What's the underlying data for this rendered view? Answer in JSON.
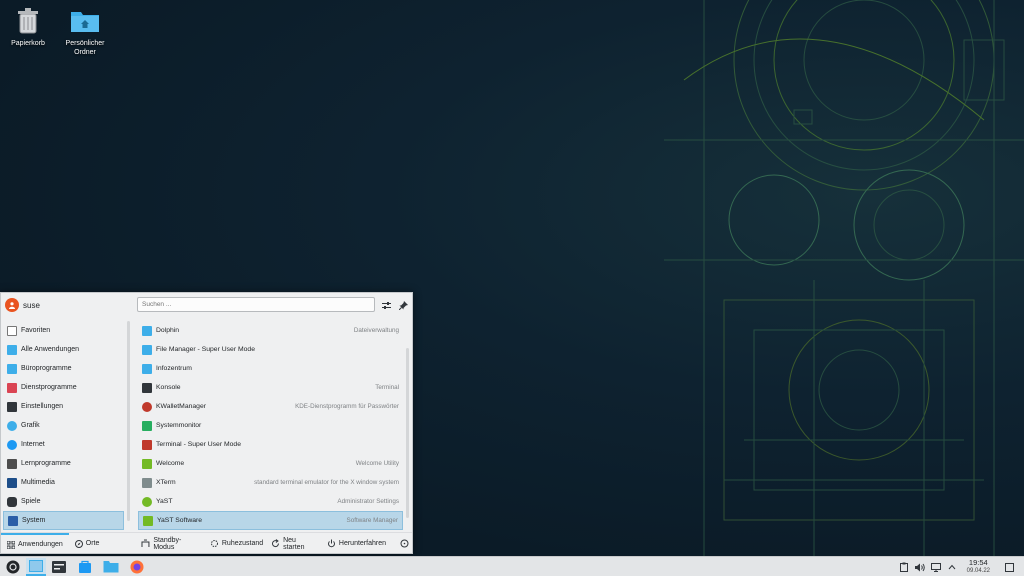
{
  "desktop": {
    "icons": [
      {
        "label": "Papierkorb",
        "icon": "trash-icon"
      },
      {
        "label": "Persönlicher Ordner",
        "icon": "home-folder-icon"
      }
    ]
  },
  "launcher": {
    "user": "suse",
    "search_placeholder": "Suchen ...",
    "categories": [
      {
        "label": "Favoriten",
        "icon": "bookmark-icon",
        "color": "#ffffff"
      },
      {
        "label": "Alle Anwendungen",
        "icon": "grid-icon",
        "color": "#3daee9"
      },
      {
        "label": "Büroprogramme",
        "icon": "office-icon",
        "color": "#3daee9"
      },
      {
        "label": "Dienstprogramme",
        "icon": "utilities-icon",
        "color": "#da4453"
      },
      {
        "label": "Einstellungen",
        "icon": "settings-icon",
        "color": "#31363b"
      },
      {
        "label": "Grafik",
        "icon": "graphics-icon",
        "color": "#3daee9"
      },
      {
        "label": "Internet",
        "icon": "globe-icon",
        "color": "#1d99f3"
      },
      {
        "label": "Lernprogramme",
        "icon": "education-icon",
        "color": "#4d4d4d"
      },
      {
        "label": "Multimedia",
        "icon": "multimedia-icon",
        "color": "#1d4e89"
      },
      {
        "label": "Spiele",
        "icon": "gamepad-icon",
        "color": "#31363b"
      },
      {
        "label": "System",
        "icon": "system-icon",
        "color": "#2b5ea7"
      }
    ],
    "active_category": "System",
    "apps": [
      {
        "name": "Dolphin",
        "desc": "Dateiverwaltung",
        "icon": "folder-icon",
        "color": "#3daee9"
      },
      {
        "name": "File Manager - Super User Mode",
        "desc": "",
        "icon": "folder-icon",
        "color": "#3daee9"
      },
      {
        "name": "Infozentrum",
        "desc": "",
        "icon": "info-icon",
        "color": "#3daee9"
      },
      {
        "name": "Konsole",
        "desc": "Terminal",
        "icon": "terminal-icon",
        "color": "#31363b"
      },
      {
        "name": "KWalletManager",
        "desc": "KDE-Dienstprogramm für Passwörter",
        "icon": "wallet-icon",
        "color": "#c0392b"
      },
      {
        "name": "Systemmonitor",
        "desc": "",
        "icon": "monitor-icon",
        "color": "#27ae60"
      },
      {
        "name": "Terminal - Super User Mode",
        "desc": "",
        "icon": "terminal-icon",
        "color": "#c0392b"
      },
      {
        "name": "Welcome",
        "desc": "Welcome Utility",
        "icon": "welcome-icon",
        "color": "#73ba25"
      },
      {
        "name": "XTerm",
        "desc": "standard terminal emulator for the X window system",
        "icon": "xterm-icon",
        "color": "#7f8c8d"
      },
      {
        "name": "YaST",
        "desc": "Administrator Settings",
        "icon": "yast-icon",
        "color": "#73ba25"
      },
      {
        "name": "YaST Software",
        "desc": "Software Manager",
        "icon": "yast-software-icon",
        "color": "#73ba25"
      }
    ],
    "active_app": "YaST Software",
    "footer": {
      "tab_apps": "Anwendungen",
      "tab_places": "Orte",
      "standby": "Standby-Modus",
      "hibernate": "Ruhezustand",
      "restart": "Neu starten",
      "shutdown": "Herunterfahren"
    }
  },
  "taskbar": {
    "time": "19:54",
    "date": "09.04.22"
  },
  "colors": {
    "accent": "#3daee9",
    "selection": "#b8d6e8",
    "panel": "#eff0f1"
  }
}
